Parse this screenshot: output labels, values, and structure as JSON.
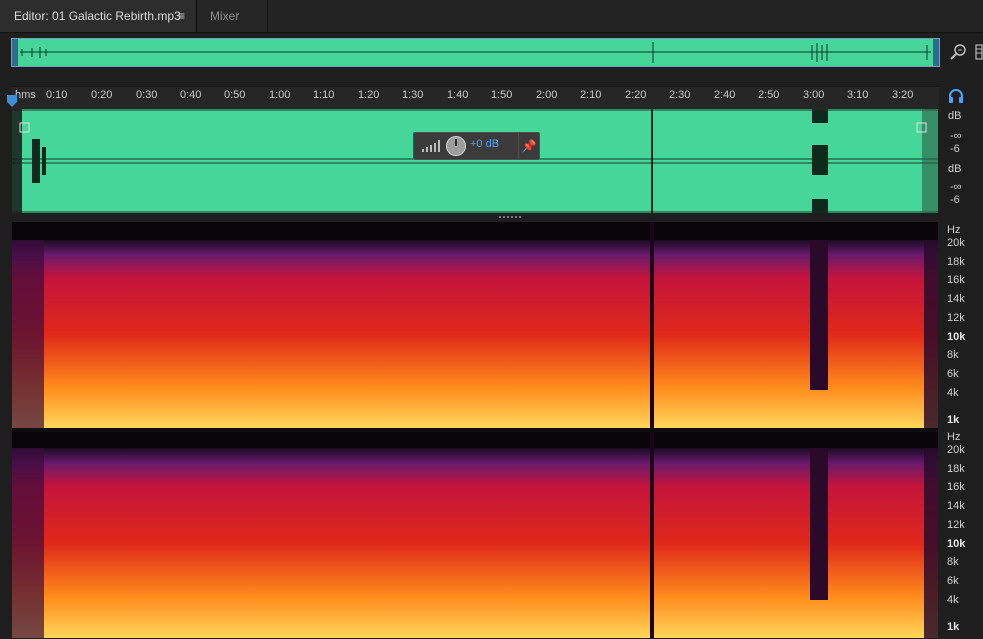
{
  "tabs": {
    "editor_label": "Editor: 01 Galactic Rebirth.mp3",
    "editor_menu": "≡",
    "mixer_label": "Mixer"
  },
  "ruler": {
    "unit": "hms",
    "ticks": [
      "0:10",
      "0:20",
      "0:30",
      "0:40",
      "0:50",
      "1:00",
      "1:10",
      "1:20",
      "1:30",
      "1:40",
      "1:50",
      "2:00",
      "2:10",
      "2:20",
      "2:30",
      "2:40",
      "2:50",
      "3:00",
      "3:10",
      "3:20"
    ]
  },
  "db_scale": {
    "unit": "dB",
    "top_channel": [
      "dB",
      "-∞",
      "-6"
    ],
    "bottom_channel": [
      "dB",
      "-∞",
      "-6"
    ]
  },
  "hud": {
    "gain": "+0 dB",
    "pin": "📌"
  },
  "spectrogram": {
    "unit": "Hz",
    "labels": [
      "20k",
      "18k",
      "16k",
      "14k",
      "12k",
      "10k",
      "8k",
      "6k",
      "4k",
      "1k"
    ]
  },
  "colors": {
    "waveform": "#46d69a",
    "accent": "#4aa3ff",
    "background": "#1e1e1e"
  },
  "icons": {
    "zoom": "zoom-icon",
    "headphone": "headphone-icon",
    "playhead": "playhead-marker"
  }
}
